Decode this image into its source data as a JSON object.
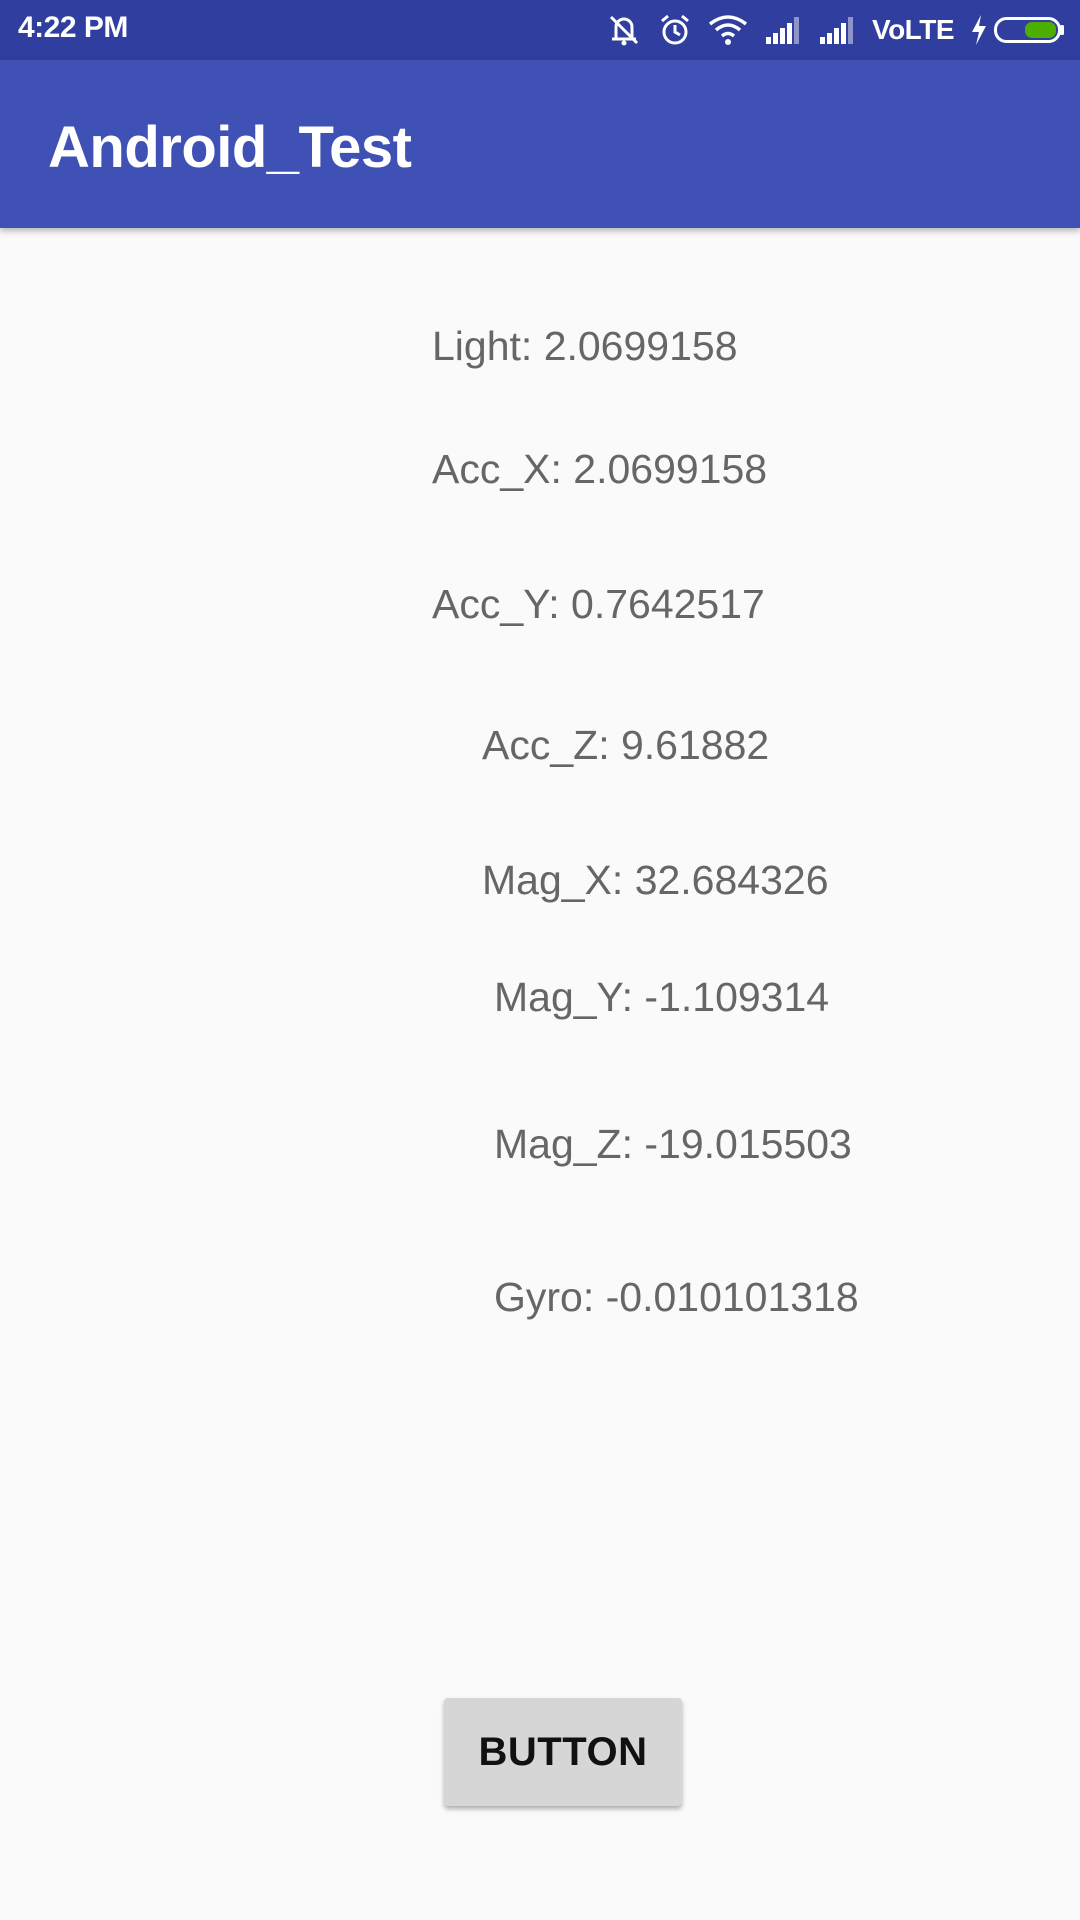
{
  "status_bar": {
    "time": "4:22 PM",
    "network": "VoLTE",
    "icons": [
      "vibrate-off-icon",
      "alarm-icon",
      "wifi-icon",
      "signal-icon",
      "signal-icon",
      "charging-icon",
      "battery-icon"
    ],
    "battery_color": "#4caf00",
    "background": "#303f9f"
  },
  "app_bar": {
    "title": "Android_Test",
    "background": "#3f51b5"
  },
  "readings": {
    "light": "Light: 2.0699158",
    "acc_x": "Acc_X: 2.0699158",
    "acc_y": "Acc_Y: 0.7642517",
    "acc_z": "Acc_Z: 9.61882",
    "mag_x": "Mag_X: 32.684326",
    "mag_y": "Mag_Y: -1.109314",
    "mag_z": "Mag_Z: -19.015503",
    "gyro": "Gyro: -0.010101318"
  },
  "button": {
    "label": "BUTTON"
  }
}
